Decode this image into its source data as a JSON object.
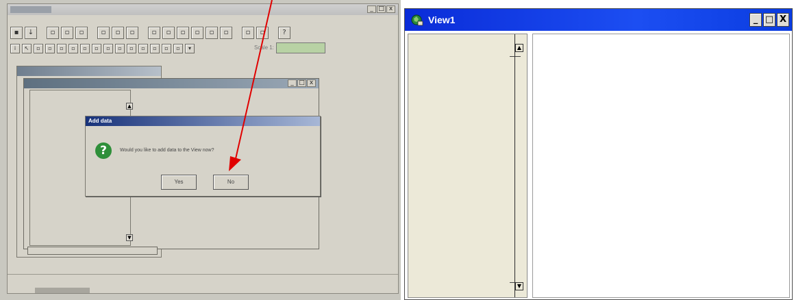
{
  "left_screenshot": {
    "dialog": {
      "title": "Add data",
      "message": "Would you like to add data to the View now?",
      "yes_label": "Yes",
      "no_label": "No",
      "icon": "question-icon"
    },
    "scale_label": "Scale 1:",
    "annotation_arrow_color": "#e00000"
  },
  "right_screenshot": {
    "window_title": "View1",
    "minimize_glyph": "_",
    "maximize_glyph": "□",
    "close_glyph": "X",
    "title_bar_color": "#1a46e8"
  }
}
